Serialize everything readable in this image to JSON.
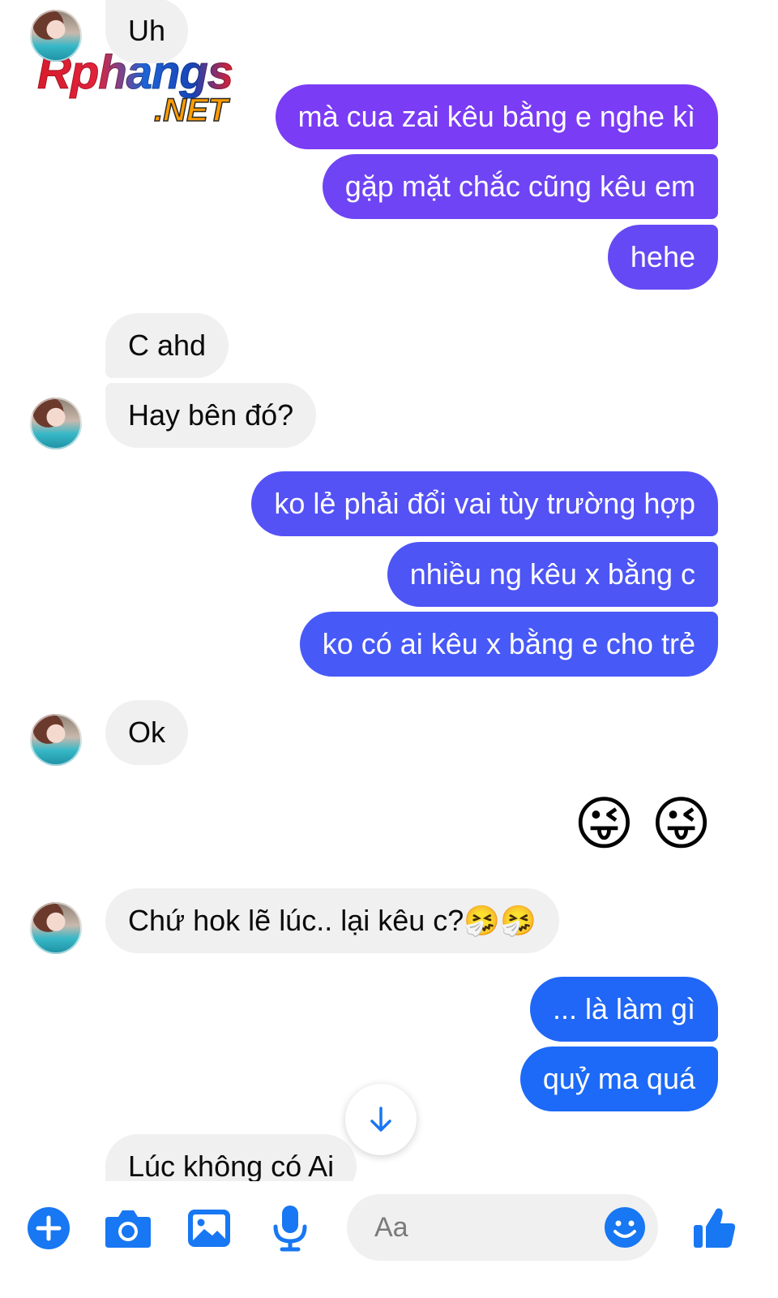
{
  "colors": {
    "accent": "#1877f2",
    "incoming_bubble": "#f0f0f0",
    "outgoing_top": "#7a3cf4",
    "outgoing_bottom": "#1c6af7"
  },
  "watermark": {
    "main": "Rphangs",
    "sub": ".NET"
  },
  "messages": [
    {
      "sender": "them",
      "text": "Uh",
      "avatar": true
    },
    {
      "sender": "me",
      "text": "mà cua zai kêu bằng e nghe kì"
    },
    {
      "sender": "me",
      "text": "gặp mặt chắc cũng kêu em"
    },
    {
      "sender": "me",
      "text": "hehe"
    },
    {
      "sender": "them",
      "text": "C ahd"
    },
    {
      "sender": "them",
      "text": "Hay bên đó?",
      "avatar": true
    },
    {
      "sender": "me",
      "text": "ko lẻ phải đổi vai tùy trường hợp"
    },
    {
      "sender": "me",
      "text": "nhiều ng kêu x bằng c"
    },
    {
      "sender": "me",
      "text": "ko có ai kêu x bằng e cho trẻ"
    },
    {
      "sender": "them",
      "text": "Ok",
      "avatar": true
    },
    {
      "sender": "me",
      "emoji": "😜 😜"
    },
    {
      "sender": "them",
      "text": "Chứ hok lẽ lúc.. lại kêu c?🤧🤧",
      "avatar": true
    },
    {
      "sender": "me",
      "text": "... là làm gì"
    },
    {
      "sender": "me",
      "text": "quỷ ma quá"
    },
    {
      "sender": "them",
      "text": "Lúc không có Ai"
    }
  ],
  "composer": {
    "placeholder": "Aa",
    "icons": [
      "plus-icon",
      "camera-icon",
      "image-icon",
      "mic-icon",
      "emoji-icon",
      "thumbs-up-icon"
    ]
  },
  "scroll_button_icon": "arrow-down-icon"
}
